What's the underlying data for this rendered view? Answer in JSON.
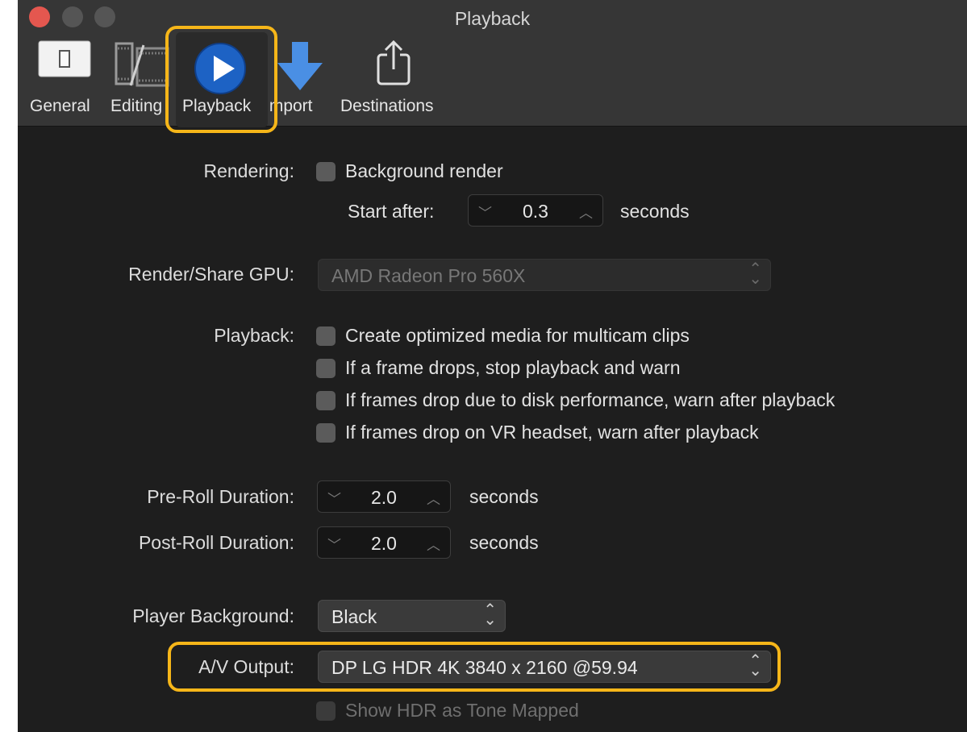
{
  "window": {
    "title": "Playback"
  },
  "toolbar": {
    "items": [
      {
        "label": "General",
        "icon": "general-switch-icon"
      },
      {
        "label": "Editing",
        "icon": "film-strip-icon"
      },
      {
        "label": "Playback",
        "icon": "play-icon",
        "selected": true
      },
      {
        "label": "Import",
        "icon": "import-arrow-icon"
      },
      {
        "label": "Destinations",
        "icon": "share-icon"
      }
    ]
  },
  "rendering": {
    "label": "Rendering:",
    "background_render": {
      "label": "Background render",
      "checked": false
    },
    "start_after_label": "Start after:",
    "start_after_value": "0.3",
    "start_after_unit": "seconds"
  },
  "gpu": {
    "label": "Render/Share GPU:",
    "value": "AMD Radeon Pro 560X",
    "enabled": false
  },
  "playback": {
    "label": "Playback:",
    "options": [
      {
        "label": "Create optimized media for multicam clips",
        "checked": false
      },
      {
        "label": "If a frame drops, stop playback and warn",
        "checked": false
      },
      {
        "label": "If frames drop due to disk performance, warn after playback",
        "checked": false
      },
      {
        "label": "If frames drop on VR headset, warn after playback",
        "checked": false
      }
    ]
  },
  "preroll": {
    "label": "Pre-Roll Duration:",
    "value": "2.0",
    "unit": "seconds"
  },
  "postroll": {
    "label": "Post-Roll Duration:",
    "value": "2.0",
    "unit": "seconds"
  },
  "player_background": {
    "label": "Player Background:",
    "value": "Black"
  },
  "av_output": {
    "label": "A/V Output:",
    "value": "DP LG HDR 4K 3840 x 2160 @59.94"
  },
  "show_hdr": {
    "label": "Show HDR as Tone Mapped",
    "checked": false,
    "enabled": false
  },
  "colors": {
    "highlight": "#f6b619",
    "accent": "#1d62c4",
    "background": "#1e1e1e"
  }
}
